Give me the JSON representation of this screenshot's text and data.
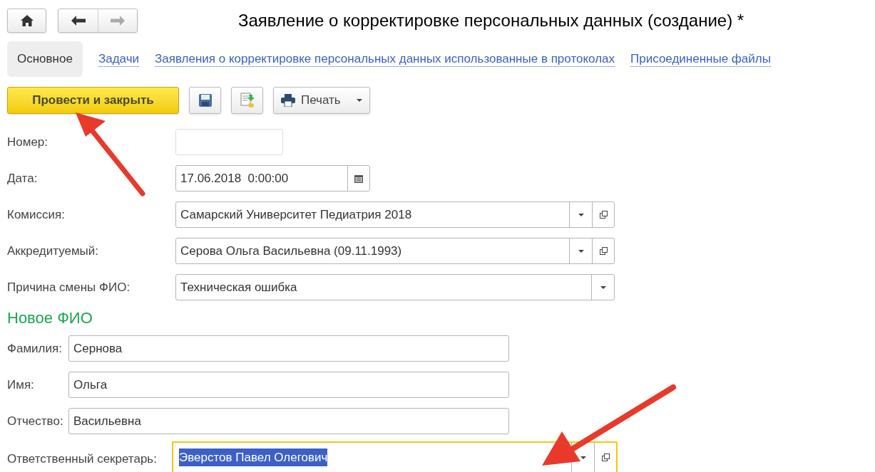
{
  "window": {
    "title": "Заявление о корректировке персональных данных (создание) *"
  },
  "tabs": [
    {
      "label": "Основное",
      "selected": true
    },
    {
      "label": "Задачи",
      "selected": false
    },
    {
      "label": "Заявления о корректировке персональных данных использованные в протоколах",
      "selected": false
    },
    {
      "label": "Присоединенные файлы",
      "selected": false
    }
  ],
  "toolbar": {
    "primary_button": "Провести и закрыть",
    "print_button": "Печать"
  },
  "fields": [
    {
      "label": "Номер:",
      "kind": "input"
    },
    {
      "label": "Дата:",
      "kind": "date",
      "value": "17.06.2018  0:00:00"
    },
    {
      "label": "Комиссия:",
      "kind": "reference",
      "value": "Самарский Университет Педиатрия 2018"
    },
    {
      "label": "Аккредитуемый:",
      "kind": "reference",
      "value": "Серова Ольга Васильевна (09.11.1993)"
    },
    {
      "label": "Причина смены ФИО:",
      "kind": "choice",
      "value": "Техническая ошибка"
    }
  ],
  "new_name_section": {
    "title": "Новое ФИО",
    "fields": [
      {
        "label": "Фамилия:",
        "value": "Сернова"
      },
      {
        "label": "Имя:",
        "value": "Ольга"
      },
      {
        "label": "Отчество:",
        "value": "Васильевна"
      }
    ]
  },
  "secretary": {
    "label": "Ответственный секретарь:",
    "value": "Эверстов Павел Олегович",
    "focused": true,
    "text_selected": true
  }
}
